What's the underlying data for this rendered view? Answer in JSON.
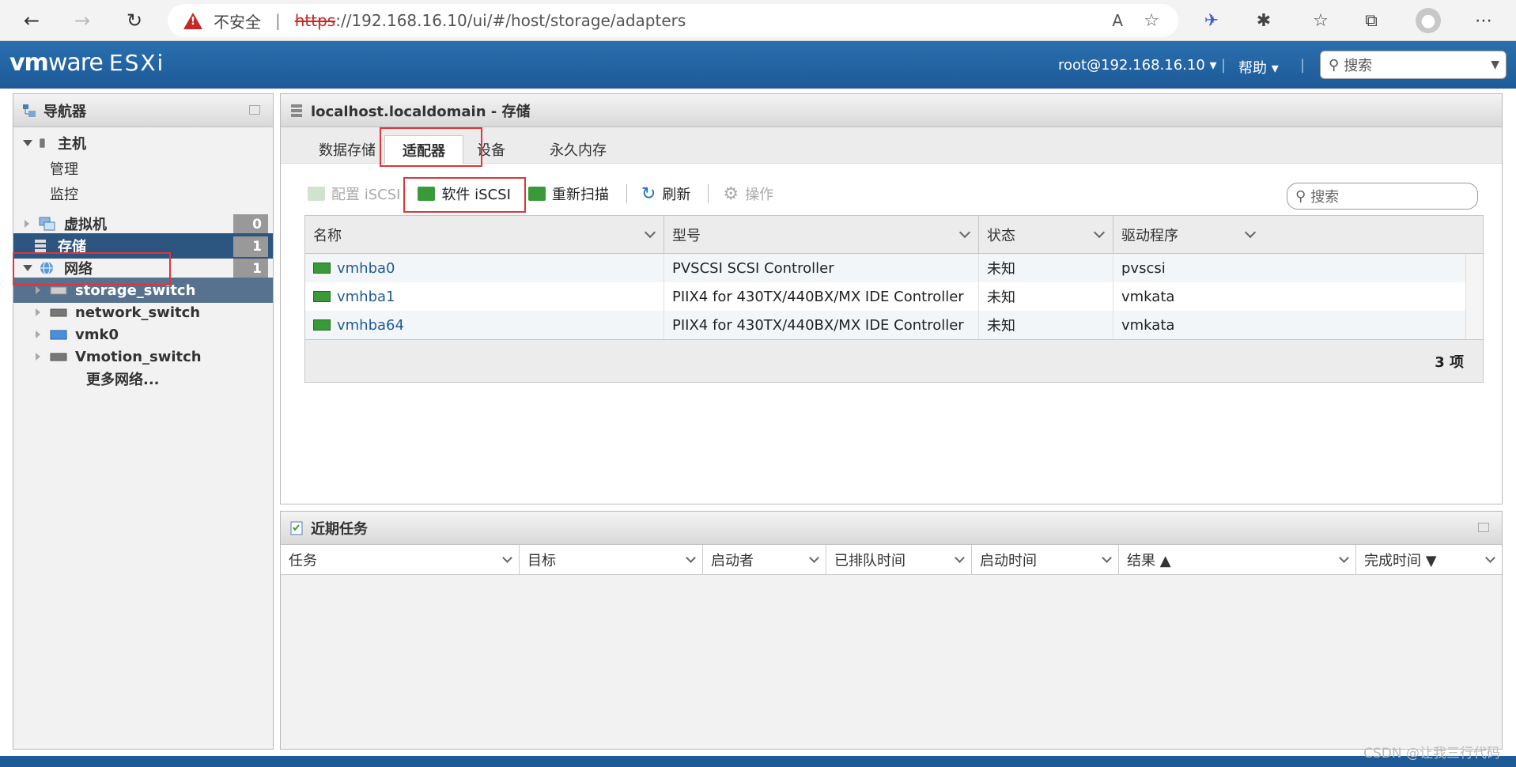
{
  "browser": {
    "insecure": "不安全",
    "url_scheme": "https",
    "url_rest": "://192.168.16.10/ui/#/host/storage/adapters"
  },
  "header": {
    "logo_vm": "vm",
    "logo_ware": "ware",
    "logo_product": "ESXi",
    "user": "root@192.168.16.10 ▾",
    "help": "帮助 ▾",
    "search_placeholder": "搜索"
  },
  "navigator": {
    "title": "导航器",
    "host": "主机",
    "manage": "管理",
    "monitor": "监控",
    "vms": "虚拟机",
    "vms_count": "0",
    "storage": "存储",
    "storage_count": "1",
    "network": "网络",
    "network_count": "1",
    "net_items": [
      "storage_switch",
      "network_switch",
      "vmk0",
      "Vmotion_switch"
    ],
    "more_networks": "更多网络..."
  },
  "content": {
    "title": "localhost.localdomain - 存储",
    "tabs": [
      "数据存储",
      "适配器",
      "设备",
      "永久内存"
    ],
    "toolbar": {
      "configure_iscsi": "配置 iSCSI",
      "software_iscsi": "软件 iSCSI",
      "rescan": "重新扫描",
      "refresh": "刷新",
      "actions": "操作"
    },
    "search_placeholder": "搜索",
    "columns": [
      "名称",
      "型号",
      "状态",
      "驱动程序"
    ],
    "rows": [
      {
        "name": "vmhba0",
        "model": "PVSCSI SCSI Controller",
        "status": "未知",
        "driver": "pvscsi"
      },
      {
        "name": "vmhba1",
        "model": "PIIX4 for 430TX/440BX/MX IDE Controller",
        "status": "未知",
        "driver": "vmkata"
      },
      {
        "name": "vmhba64",
        "model": "PIIX4 for 430TX/440BX/MX IDE Controller",
        "status": "未知",
        "driver": "vmkata"
      }
    ],
    "count": "3 项"
  },
  "tasks": {
    "title": "近期任务",
    "columns": [
      "任务",
      "目标",
      "启动者",
      "已排队时间",
      "启动时间",
      "结果 ▲",
      "完成时间 ▼"
    ]
  },
  "watermark": "CSDN @让我三行代码",
  "colors": {
    "esxi_blue": "#1d5a98",
    "selected": "#2c557f",
    "highlight_red": "#e0353a",
    "link": "#1f5a96"
  }
}
